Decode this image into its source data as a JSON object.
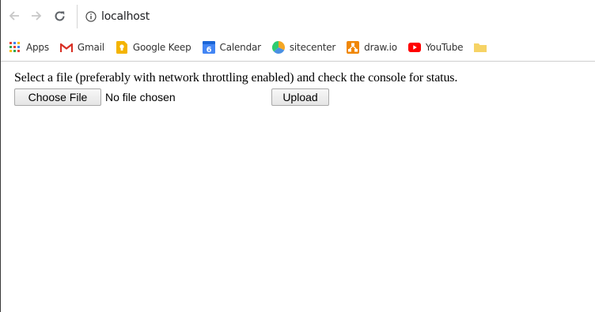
{
  "browser": {
    "url": "localhost",
    "bookmarks": [
      {
        "label": "Apps",
        "icon": "apps-grid-icon"
      },
      {
        "label": "Gmail",
        "icon": "gmail-icon"
      },
      {
        "label": "Google Keep",
        "icon": "google-keep-icon"
      },
      {
        "label": "Calendar",
        "icon": "calendar-icon"
      },
      {
        "label": "sitecenter",
        "icon": "sitecenter-icon"
      },
      {
        "label": "draw.io",
        "icon": "drawio-icon"
      },
      {
        "label": "YouTube",
        "icon": "youtube-icon"
      }
    ],
    "calendar_icon_day": "6"
  },
  "page": {
    "instructions": "Select a file (preferably with network throttling enabled) and check the console for status.",
    "choose_file_label": "Choose File",
    "no_file_text": "No file chosen",
    "upload_label": "Upload"
  },
  "colors": {
    "gmail_red": "#d93025",
    "keep_yellow": "#f4b400",
    "calendar_blue": "#4285f4",
    "drawio_orange": "#f08705",
    "youtube_red": "#ff0000"
  }
}
